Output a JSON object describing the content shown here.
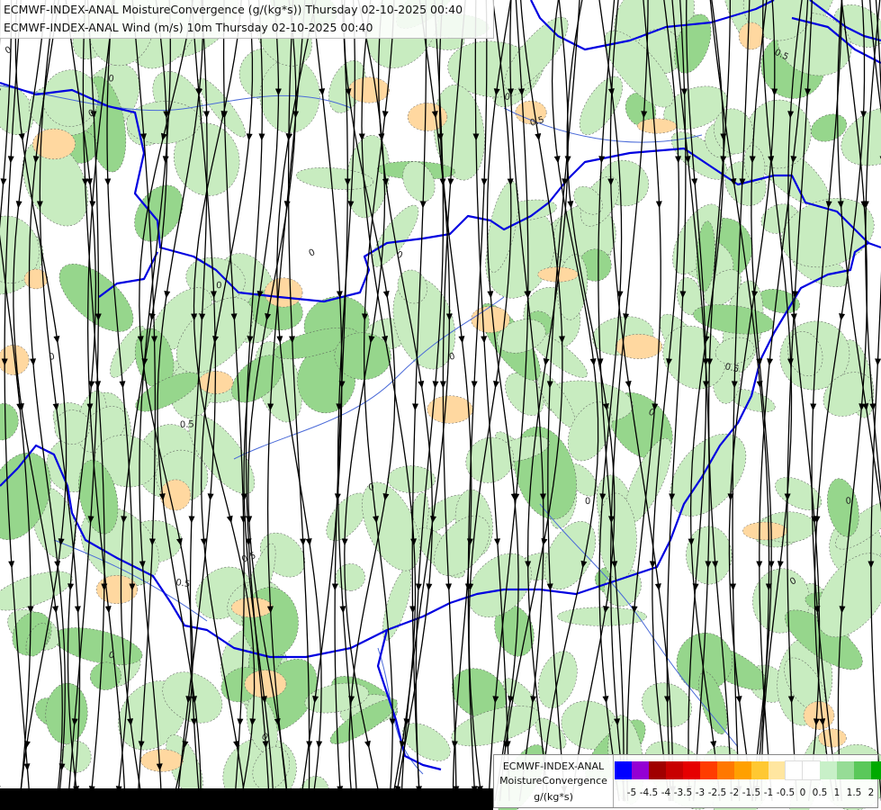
{
  "titles": {
    "line1": "ECMWF-INDEX-ANAL MoistureConvergence (g/(kg*s)) Thursday 02-10-2025 00:40",
    "line2": "ECMWF-INDEX-ANAL Wind (m/s) 10m Thursday 02-10-2025 00:40"
  },
  "legend": {
    "line1": "ECMWF-INDEX-ANAL",
    "line2": "MoistureConvergence",
    "unit": "g/(kg*s)",
    "colors": [
      "#0000ff",
      "#9400d3",
      "#a00000",
      "#c80000",
      "#e60000",
      "#ff3c00",
      "#ff7800",
      "#ffa000",
      "#ffc832",
      "#ffe6a0",
      "#ffffff",
      "#ffffff",
      "#c8f0c8",
      "#96dc96",
      "#5ac85a",
      "#00aa00"
    ],
    "ticks": [
      "-5",
      "-4.5",
      "-4",
      "-3.5",
      "-3",
      "-2.5",
      "-2",
      "-1.5",
      "-1",
      "-0.5",
      "0",
      "0.5",
      "1",
      "1.5",
      "2"
    ]
  },
  "contour_labels": [
    "0",
    "0",
    "0.5",
    "0",
    "0.5",
    "0",
    "0",
    "0",
    "0.5",
    "0",
    "0.5",
    "0",
    "0",
    "0",
    "0.5",
    "0",
    "0",
    "0",
    "0",
    "0.5",
    "0",
    "0"
  ],
  "colors": {
    "border": "#0000e0",
    "river": "#4a6ad8",
    "streamline": "#000000",
    "green_light": "#c8ecc0",
    "green_mid": "#96d68c",
    "orange_light": "#ffd8a0"
  }
}
